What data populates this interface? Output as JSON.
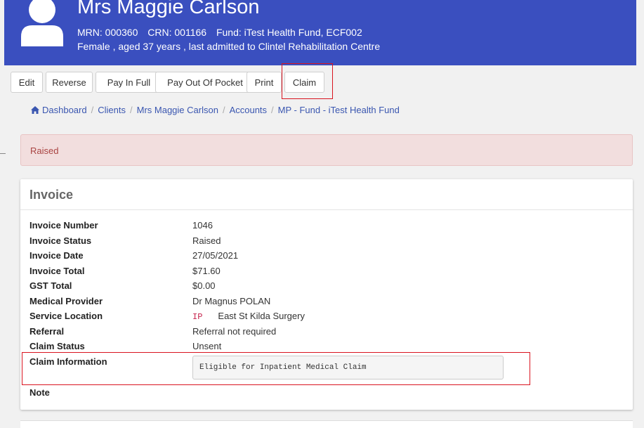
{
  "header": {
    "patient_name": "Mrs Maggie Carlson",
    "mrn": "MRN: 000360",
    "crn": "CRN: 001166",
    "fund": "Fund: iTest Health Fund, ECF002",
    "demographics": "Female , aged 37 years , last admitted to Clintel Rehabilitation Centre",
    "background_color": "#3a4fbf"
  },
  "toolbar": {
    "edit": "Edit",
    "reverse": "Reverse",
    "pay_in_full": "Pay In Full",
    "pay_out_of_pocket": "Pay Out Of Pocket",
    "print": "Print",
    "claim": "Claim"
  },
  "breadcrumb": {
    "icon": "home-icon",
    "items": [
      "Dashboard",
      "Clients",
      "Mrs Maggie Carlson",
      "Accounts",
      "MP - Fund - iTest Health Fund"
    ]
  },
  "alert": {
    "text": "Raised",
    "color": "#a94442"
  },
  "invoice": {
    "title": "Invoice",
    "rows": [
      {
        "label": "Invoice Number",
        "value": "1046"
      },
      {
        "label": "Invoice Status",
        "value": "Raised"
      },
      {
        "label": "Invoice Date",
        "value": "27/05/2021"
      },
      {
        "label": "Invoice Total",
        "value": "$71.60"
      },
      {
        "label": "GST Total",
        "value": "$0.00"
      },
      {
        "label": "Medical Provider",
        "value": "Dr Magnus POLAN"
      },
      {
        "label": "Service Location",
        "code": "IP",
        "value": "East St Kilda Surgery"
      },
      {
        "label": "Referral",
        "value": "Referral not required"
      },
      {
        "label": "Claim Status",
        "value": "Unsent"
      },
      {
        "label": "Claim Information",
        "value": "Eligible for Inpatient Medical Claim"
      },
      {
        "label": "Note",
        "value": ""
      }
    ]
  },
  "highlight_color": "#d9141f"
}
